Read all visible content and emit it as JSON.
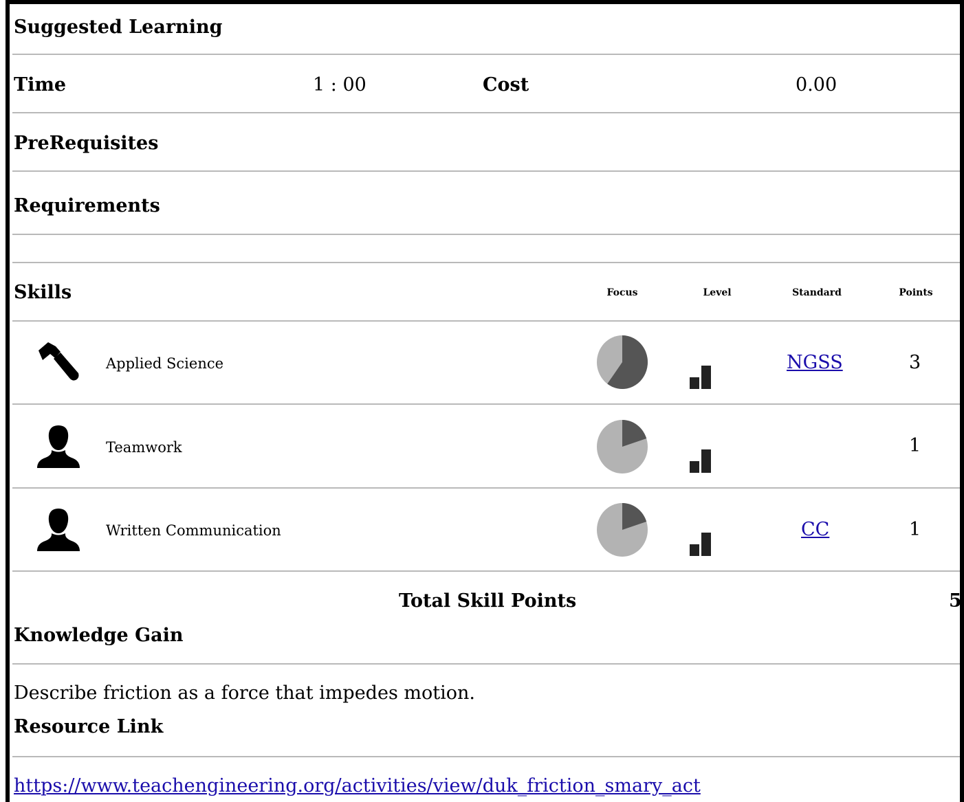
{
  "header": {
    "title": "Suggested Learning"
  },
  "time": {
    "label": "Time",
    "value": "1 : 00"
  },
  "cost": {
    "label": "Cost",
    "value": "0.00"
  },
  "prerequisites": {
    "label": "PreRequisites"
  },
  "requirements": {
    "label": "Requirements"
  },
  "skills": {
    "label": "Skills",
    "columns": [
      "Focus",
      "Level",
      "Standard",
      "Points"
    ],
    "rows": [
      {
        "icon": "hammer-icon",
        "name": "Applied Science",
        "focus_fraction": 0.6,
        "level": 2,
        "standard": "NGSS",
        "points": "3"
      },
      {
        "icon": "person-icon",
        "name": "Teamwork",
        "focus_fraction": 0.2,
        "level": 2,
        "standard": "",
        "points": "1"
      },
      {
        "icon": "person-icon",
        "name": "Written Communication",
        "focus_fraction": 0.2,
        "level": 2,
        "standard": "CC",
        "points": "1"
      }
    ],
    "total_label": "Total Skill Points",
    "total_value": "5"
  },
  "knowledge": {
    "label": "Knowledge Gain",
    "text": "Describe friction as a force that impedes motion."
  },
  "resource": {
    "label": "Resource Link",
    "url": "https://www.teachengineering.org/activities/view/duk_friction_smary_act"
  },
  "colors": {
    "pie_dark": "#555555",
    "pie_light": "#b3b3b3",
    "link": "#1a0dab"
  }
}
